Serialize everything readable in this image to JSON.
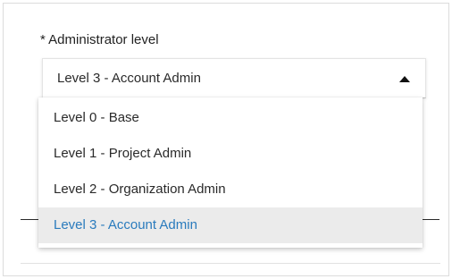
{
  "field": {
    "label": "* Administrator level",
    "selected_value": "Level 3 - Account Admin",
    "expanded": true
  },
  "menu": {
    "options": [
      {
        "label": "Level 0 - Base",
        "selected": false
      },
      {
        "label": "Level 1 - Project Admin",
        "selected": false
      },
      {
        "label": "Level 2 - Organization Admin",
        "selected": false
      },
      {
        "label": "Level 3 - Account Admin",
        "selected": true
      }
    ]
  },
  "colors": {
    "selected_text": "#2a7bbd",
    "selected_background": "#ebebeb",
    "text": "#2a2a2a"
  },
  "icons": {
    "dropdown_toggle": "caret-up-icon"
  }
}
